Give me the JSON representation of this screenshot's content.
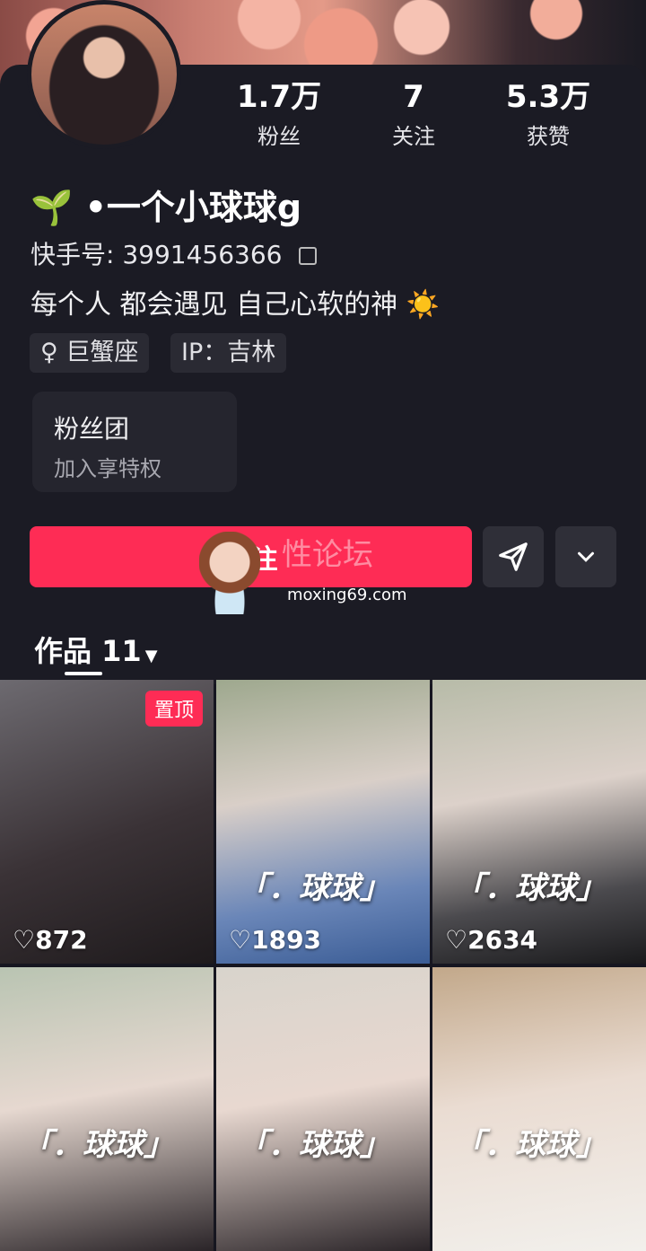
{
  "profile": {
    "stats": [
      {
        "value": "1.7万",
        "label": "粉丝"
      },
      {
        "value": "7",
        "label": "关注"
      },
      {
        "value": "5.3万",
        "label": "获赞"
      }
    ],
    "name_icon": "🌱",
    "name": "•一个小球球ց",
    "kuaishou_id": "快手号: 3991456366",
    "bio": "每个人 都会遇见 自己心软的神 ☀️",
    "tags": [
      "♀ 巨蟹座",
      "IP：吉林"
    ],
    "fan_group": {
      "title": "粉丝团",
      "subtitle": "加入享特权"
    }
  },
  "actions": {
    "follow_label": "关注",
    "share_icon": "send-icon",
    "more_icon": "chevron-down-icon"
  },
  "watermark": {
    "text": "性论坛",
    "url": "moxing69.com"
  },
  "works": {
    "label": "作品 11",
    "items": [
      {
        "likes": "872",
        "pinned": "置顶",
        "caption": ""
      },
      {
        "likes": "1893",
        "caption": "「．球球」"
      },
      {
        "likes": "2634",
        "caption": "「．球球」"
      },
      {
        "likes": "",
        "caption": "「．球球」"
      },
      {
        "likes": "",
        "caption": "「．球球」"
      },
      {
        "likes": "",
        "caption": "「．球球」"
      }
    ]
  }
}
